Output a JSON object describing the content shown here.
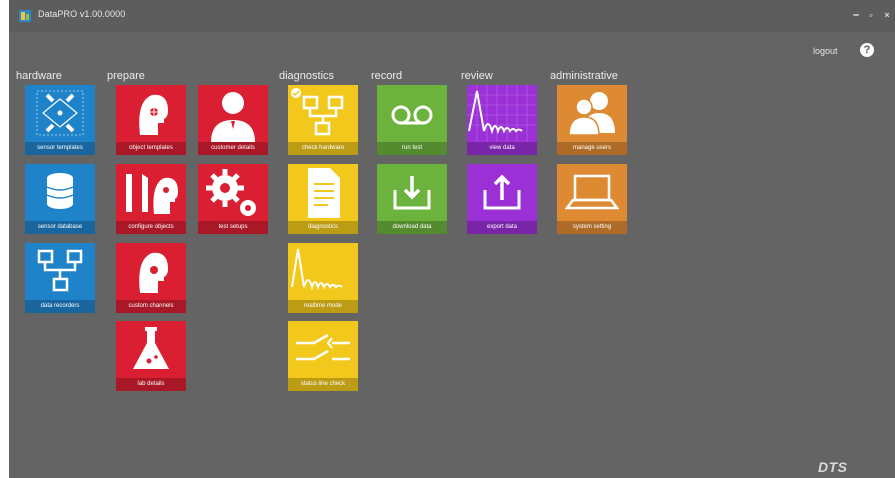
{
  "app": {
    "title": "DataPRO v1.00.0000"
  },
  "window_controls": {
    "minimize": "–",
    "maximize": "▫",
    "close": "×"
  },
  "header": {
    "logout": "logout",
    "help": "?"
  },
  "categories": {
    "hardware": "hardware",
    "prepare": "prepare",
    "diagnostics": "diagnostics",
    "record": "record",
    "review": "review",
    "administrative": "administrative"
  },
  "tiles": {
    "sensor_templates": "sensor templates",
    "sensor_database": "sensor database",
    "data_recorders": "data recorders",
    "object_templates": "object templates",
    "configure_objects": "configure objects",
    "custom_channels": "custom channels",
    "lab_details": "lab details",
    "customer_details": "customer details",
    "test_setups": "test setups",
    "check_hardware": "check hardware",
    "diagnostics": "diagnostics",
    "realtime_mode": "realtime mode",
    "status_line_check": "status line check",
    "run_test": "run test",
    "download_data": "download data",
    "view_data": "view data",
    "export_data": "export data",
    "manage_users": "manage users",
    "system_setting": "system setting"
  },
  "brand": {
    "logo": "DTS"
  },
  "colors": {
    "background": "#646464",
    "hardware_blue": "#1f83c9",
    "prepare_red": "#d91f31",
    "diagnostics_yellow": "#f3c81c",
    "record_green": "#6cb33d",
    "review_purple": "#9b30d6",
    "admin_orange": "#de8a32"
  }
}
